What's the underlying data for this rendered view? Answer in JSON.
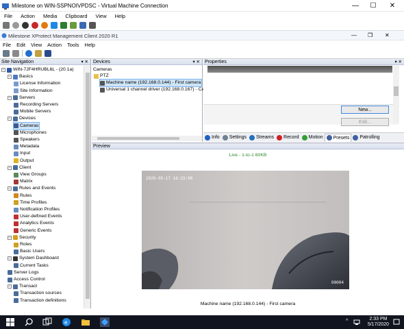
{
  "vm": {
    "title": "Milestone on WIN-SSPNOIVPDSC - Virtual Machine Connection",
    "menu": [
      "File",
      "Action",
      "Media",
      "Clipboard",
      "View",
      "Help"
    ],
    "controls": {
      "minimize": "—",
      "maximize": "☐",
      "close": "✕"
    }
  },
  "app": {
    "title": "Milestone XProtect Management Client 2020 R1",
    "menu": [
      "File",
      "Edit",
      "View",
      "Action",
      "Tools",
      "Help"
    ]
  },
  "nav": {
    "header": "Site Navigation",
    "pin": "▾ ✕",
    "items": [
      {
        "label": "WIN-7JF4HRUBL6L - (20.1a)",
        "level": 0,
        "expand": "−",
        "icon": "computer-icon",
        "color": "#2b5aa8"
      },
      {
        "label": "Basics",
        "level": 1,
        "expand": "−",
        "icon": "basics-icon",
        "color": "#4a7ac0"
      },
      {
        "label": "License Information",
        "level": 2,
        "icon": "license-icon",
        "color": "#7a9bd0"
      },
      {
        "label": "Site Information",
        "level": 2,
        "icon": "info-icon",
        "color": "#7a9bd0"
      },
      {
        "label": "Servers",
        "level": 1,
        "expand": "−",
        "icon": "servers-icon",
        "color": "#4a6c9a"
      },
      {
        "label": "Recording Servers",
        "level": 2,
        "icon": "recording-server-icon",
        "color": "#4a6c9a"
      },
      {
        "label": "Mobile Servers",
        "level": 2,
        "icon": "mobile-server-icon",
        "color": "#4a6c9a"
      },
      {
        "label": "Devices",
        "level": 1,
        "expand": "−",
        "icon": "devices-icon",
        "color": "#4a6c9a"
      },
      {
        "label": "Cameras",
        "level": 2,
        "icon": "camera-icon",
        "color": "#3a5a90",
        "selected": true
      },
      {
        "label": "Microphones",
        "level": 2,
        "icon": "microphone-icon",
        "color": "#555"
      },
      {
        "label": "Speakers",
        "level": 2,
        "icon": "speaker-icon",
        "color": "#555"
      },
      {
        "label": "Metadata",
        "level": 2,
        "icon": "metadata-icon",
        "color": "#6a8ac0"
      },
      {
        "label": "Input",
        "level": 2,
        "icon": "input-icon",
        "color": "#6a8ac0"
      },
      {
        "label": "Output",
        "level": 2,
        "icon": "output-icon",
        "color": "#e0b020"
      },
      {
        "label": "Client",
        "level": 1,
        "expand": "−",
        "icon": "client-icon",
        "color": "#4a6c9a"
      },
      {
        "label": "View Groups",
        "level": 2,
        "icon": "view-groups-icon",
        "color": "#5a8a5a"
      },
      {
        "label": "Matrix",
        "level": 2,
        "icon": "matrix-icon",
        "color": "#a03a3a"
      },
      {
        "label": "Rules and Events",
        "level": 1,
        "expand": "−",
        "icon": "rules-icon",
        "color": "#4a6c9a"
      },
      {
        "label": "Rules",
        "level": 2,
        "icon": "rule-icon",
        "color": "#d08a20"
      },
      {
        "label": "Time Profiles",
        "level": 2,
        "icon": "time-profile-icon",
        "color": "#d0a020"
      },
      {
        "label": "Notification Profiles",
        "level": 2,
        "icon": "notification-icon",
        "color": "#6a8ac0"
      },
      {
        "label": "User-defined Events",
        "level": 2,
        "icon": "user-event-icon",
        "color": "#c03030"
      },
      {
        "label": "Analytics Events",
        "level": 2,
        "icon": "analytics-icon",
        "color": "#c03030"
      },
      {
        "label": "Generic Events",
        "level": 2,
        "icon": "generic-event-icon",
        "color": "#c03030"
      },
      {
        "label": "Security",
        "level": 1,
        "expand": "−",
        "icon": "security-icon",
        "color": "#d0a020"
      },
      {
        "label": "Roles",
        "level": 2,
        "icon": "roles-icon",
        "color": "#d0a020"
      },
      {
        "label": "Basic Users",
        "level": 2,
        "icon": "basic-users-icon",
        "color": "#4a6c9a"
      },
      {
        "label": "System Dashboard",
        "level": 1,
        "expand": "−",
        "icon": "dashboard-icon",
        "color": "#333"
      },
      {
        "label": "Current Tasks",
        "level": 2,
        "icon": "tasks-icon",
        "color": "#4a6c9a"
      },
      {
        "label": "Server Logs",
        "level": 1,
        "icon": "server-logs-icon",
        "color": "#4a6c9a"
      },
      {
        "label": "Access Control",
        "level": 1,
        "icon": "access-control-icon",
        "color": "#4a6c9a"
      },
      {
        "label": "Transact",
        "level": 1,
        "expand": "−",
        "icon": "transact-icon",
        "color": "#4a6c9a"
      },
      {
        "label": "Transaction sources",
        "level": 2,
        "icon": "transaction-source-icon",
        "color": "#4a6c9a"
      },
      {
        "label": "Transaction definitions",
        "level": 2,
        "icon": "transaction-def-icon",
        "color": "#4a6c9a"
      }
    ]
  },
  "devices": {
    "header": "Devices",
    "pin": "▾ ✕",
    "root": "Cameras",
    "group": "PTZ",
    "items": [
      "Machine name (192.168.0.144) - First camera",
      "Universal 1 channel driver (192.168.0.167) - Ca"
    ]
  },
  "properties": {
    "header": "Properties",
    "pin": "▾ ✕",
    "new_button": "New...",
    "edit_button": "Edit...",
    "tabs": [
      {
        "label": "Info",
        "color": "#2060c0"
      },
      {
        "label": "Settings",
        "color": "#708090"
      },
      {
        "label": "Streams",
        "color": "#2070c0"
      },
      {
        "label": "Record",
        "color": "#d02020"
      },
      {
        "label": "Motion",
        "color": "#30a030"
      },
      {
        "label": "Presets",
        "color": "#4060a0"
      },
      {
        "label": "Patrolling",
        "color": "#4060a0"
      }
    ]
  },
  "preview": {
    "header": "Preview",
    "live_status": "Live - 1-to-1 60KB",
    "caption": "Machine name (192.168.0.144) - First camera",
    "overlay_timestamp": "2020-05-17 16:33:00",
    "overlay_counter": "00004"
  },
  "taskbar": {
    "time": "2:33 PM",
    "date": "5/17/2020",
    "chevron": "^"
  }
}
